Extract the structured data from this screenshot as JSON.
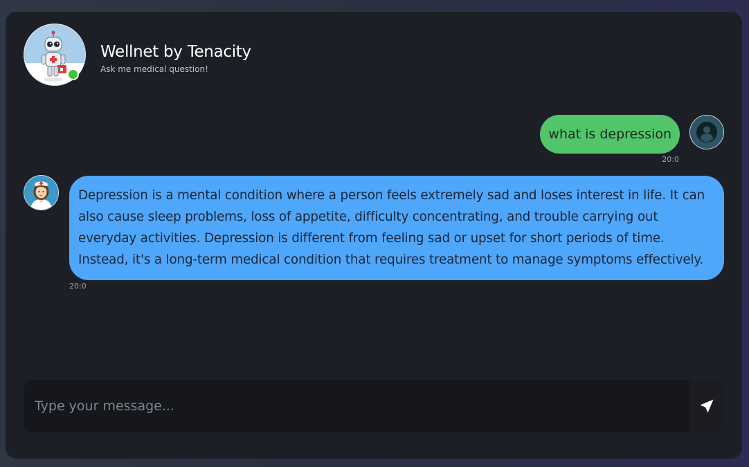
{
  "header": {
    "title": "Wellnet by Tenacity",
    "subtitle": "Ask me medical question!",
    "status": "online",
    "status_color": "#3cc43c",
    "bot_avatar_icon": "robot-doctor-icon"
  },
  "messages": [
    {
      "sender": "user",
      "text": "what is depression",
      "time": "20:0",
      "bubble_color": "#52c56a",
      "avatar_icon": "user-silhouette-icon"
    },
    {
      "sender": "bot",
      "text": "Depression is a mental condition where a person feels extremely sad and loses interest in life. It can also cause sleep problems, loss of appetite, difficulty concentrating, and trouble carrying out everyday activities. Depression is different from feeling sad or upset for short periods of time. Instead, it's a long-term medical condition that requires treatment to manage symptoms effectively.",
      "time": "20:0",
      "bubble_color": "#4fa7fb",
      "avatar_icon": "nurse-icon"
    }
  ],
  "composer": {
    "placeholder": "Type your message...",
    "value": "",
    "send_icon": "send-arrow-icon"
  }
}
